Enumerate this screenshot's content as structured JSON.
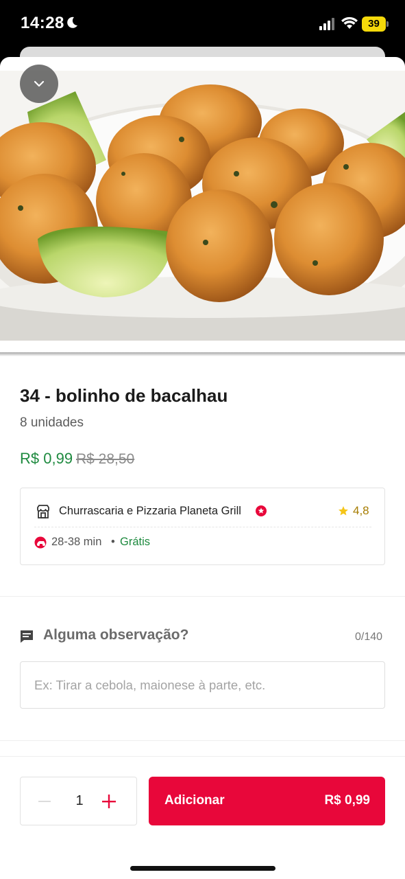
{
  "status_bar": {
    "time": "14:28",
    "battery_level": "39",
    "icons": [
      "moon-icon",
      "signal-icon",
      "wifi-icon",
      "battery-icon"
    ]
  },
  "hero": {
    "collapse_icon": "chevron-down-icon"
  },
  "product": {
    "title": "34 - bolinho de bacalhau",
    "subtitle": "8 unidades",
    "price_now": "R$ 0,99",
    "price_old": "R$ 28,50"
  },
  "store": {
    "name": "Churrascaria e Pizzaria Planeta Grill",
    "rating": "4,8",
    "delivery_time": "28-38 min",
    "separator": "•",
    "delivery_fee": "Grátis",
    "icons": [
      "store-icon",
      "badge-icon",
      "star-icon",
      "delivery-icon"
    ]
  },
  "observation": {
    "title": "Alguma observação?",
    "counter": "0/140",
    "placeholder": "Ex: Tirar a cebola, maionese à parte, etc.",
    "value": ""
  },
  "cart": {
    "quantity": "1",
    "add_label": "Adicionar",
    "add_price": "R$ 0,99"
  },
  "colors": {
    "accent": "#E8073A",
    "price_green": "#1E8A3F",
    "rating_gold": "#A67C00"
  }
}
